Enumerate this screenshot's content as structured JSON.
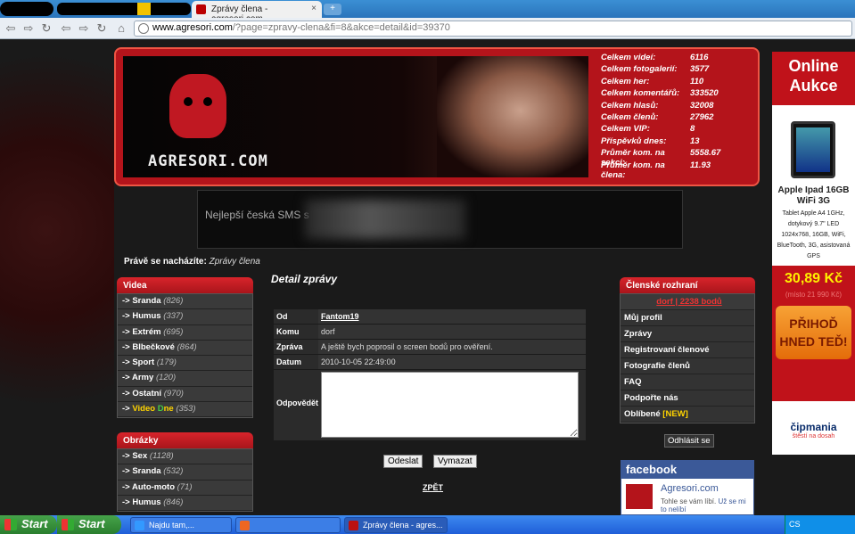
{
  "browser": {
    "tab_title": "Zprávy člena - agresori.com",
    "close_glyph": "×",
    "new_tab_glyph": "+",
    "url_domain": "www.agresori.com",
    "url_path": "/?page=zpravy-clena&fi=8&akce=detail&id=39370",
    "nav_icons": [
      "back-icon",
      "forward-icon",
      "reload-icon",
      "back-icon",
      "forward-icon",
      "reload-icon",
      "home-icon"
    ],
    "nav_glyphs": [
      "⇦",
      "⇨",
      "↻",
      "⇦",
      "⇨",
      "↻",
      "⌂"
    ]
  },
  "header": {
    "logo_text": "AGRESORI.COM",
    "stats": [
      {
        "label": "Celkem videí:",
        "value": "6116"
      },
      {
        "label": "Celkem fotogalerií:",
        "value": "3577"
      },
      {
        "label": "Celkem her:",
        "value": "110"
      },
      {
        "label": "Celkem komentářů:",
        "value": "333520"
      },
      {
        "label": "Celkem hlasů:",
        "value": "32008"
      },
      {
        "label": "Celkem členů:",
        "value": "27962"
      },
      {
        "label": "Celkem VIP:",
        "value": "8"
      },
      {
        "label": "Příspěvků dnes:",
        "value": "13"
      },
      {
        "label": "Průměr kom. na sekci:",
        "value": "5558.67"
      },
      {
        "label": "Průměr kom. na člena:",
        "value": "11.93"
      }
    ]
  },
  "banner": {
    "text": "Nejlepší česká SMS s"
  },
  "location": {
    "label": "Právě se nacházíte:",
    "value": "Zprávy člena"
  },
  "videa": {
    "title": "Videa",
    "items": [
      {
        "label": "-> Sranda",
        "count": "(826)"
      },
      {
        "label": "-> Humus",
        "count": "(337)"
      },
      {
        "label": "-> Extrém",
        "count": "(695)"
      },
      {
        "label": "-> Blbečkové",
        "count": "(864)"
      },
      {
        "label": "-> Sport",
        "count": "(179)"
      },
      {
        "label": "-> Army",
        "count": "(120)"
      },
      {
        "label": "-> Ostatní",
        "count": "(970)"
      },
      {
        "label_prefix": "-> ",
        "label_a": "Video ",
        "label_b": "D",
        "label_c": "ne",
        "count": "(353)"
      }
    ]
  },
  "obrazky": {
    "title": "Obrázky",
    "items": [
      {
        "label": "-> Sex",
        "count": "(1128)"
      },
      {
        "label": "-> Sranda",
        "count": "(532)"
      },
      {
        "label": "-> Auto-moto",
        "count": "(71)"
      },
      {
        "label": "-> Humus",
        "count": "(846)"
      }
    ]
  },
  "message": {
    "title": "Detail zprávy",
    "rows": [
      {
        "key": "Od",
        "value": "Fantom19"
      },
      {
        "key": "Komu",
        "value": "dorf"
      },
      {
        "key": "Zpráva",
        "value": "A ještě bych poprosil o screen bodů pro ověření."
      },
      {
        "key": "Datum",
        "value": "2010-10-05 22:49:00"
      }
    ],
    "reply_label": "Odpovědět",
    "reply_value": "",
    "send_label": "Odeslat",
    "clear_label": "Vymazat",
    "back_label": "ZPĚT"
  },
  "member": {
    "title": "Členské rozhraní",
    "user_link": "dorf | 2238 bodů",
    "items": [
      "Můj profil",
      "Zprávy",
      "Registrovaní členové",
      "Fotografie členů",
      "FAQ",
      "Podpořte nás"
    ],
    "favorite_label": "Oblíbené",
    "favorite_badge": "[NEW]",
    "logout_label": "Odhlásit se"
  },
  "facebook": {
    "header": "facebook",
    "page_name": "Agresori.com",
    "like_text": "Tohle se vám líbí.",
    "undo_text": "Už se mi to nelíbí"
  },
  "ad": {
    "headline_1": "Online",
    "headline_2": "Aukce",
    "product": "Apple Ipad 16GB WiFi 3G",
    "specs": "Tablet Apple A4 1GHz, dotykový 9.7\" LED 1024x768, 16GB, WiFi, BlueTooth, 3G, asistovaná GPS",
    "price": "30,89 Kč",
    "old_price": "(místo 21 990 Kč)",
    "cta": "PŘIHOĎ HNED TEĎ!",
    "brand": "čipmania",
    "brand_tagline": "štěstí na dosah"
  },
  "taskbar": {
    "start_label": "Start",
    "items": [
      "Najdu tam,...",
      "",
      "Zprávy člena - agres..."
    ],
    "tray_lang": "CS"
  },
  "colors": {
    "accent": "#b4141b",
    "menu_bg": "#3a3a3a",
    "facebook": "#3b5998",
    "highlight": "#ffd400"
  }
}
